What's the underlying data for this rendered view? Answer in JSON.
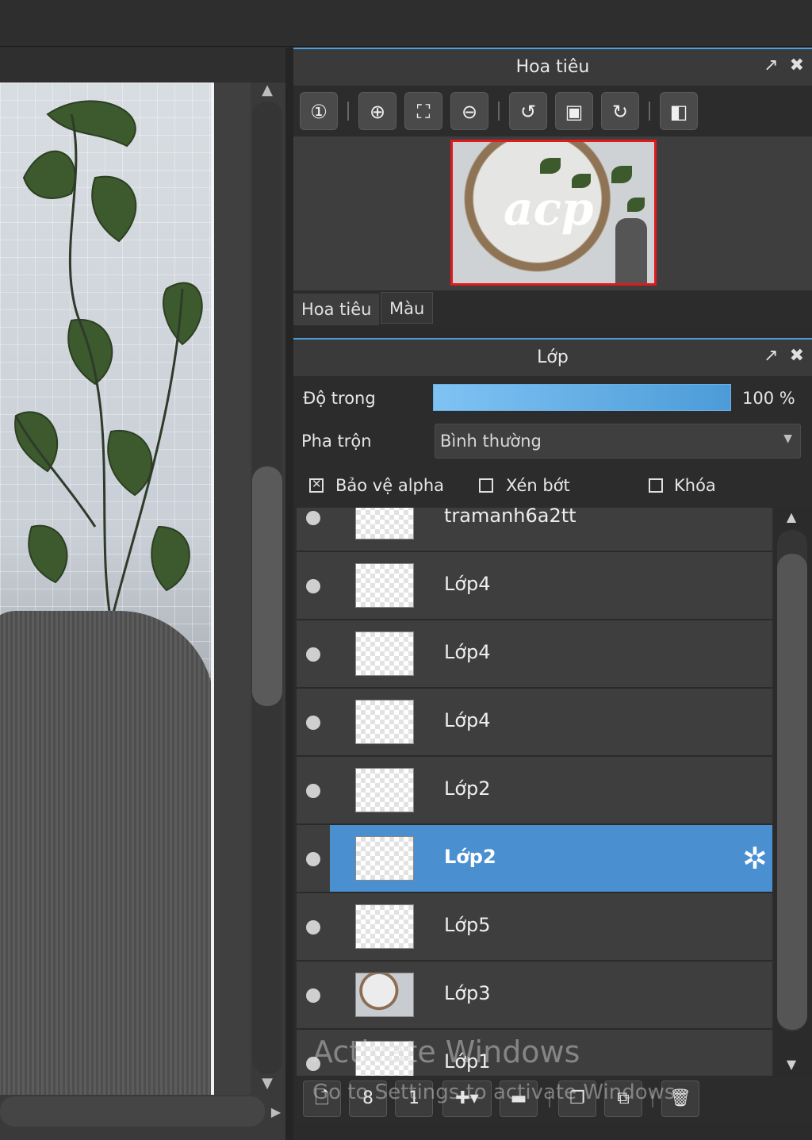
{
  "navigator": {
    "title": "Hoa tiêu",
    "popout_icon": "↗",
    "close_icon": "✖",
    "tools": [
      {
        "icon": "zoom-actual-icon",
        "glyph": "①"
      },
      {
        "icon": "zoom-in-icon",
        "glyph": "⊕"
      },
      {
        "icon": "fit-screen-icon",
        "glyph": "⛶"
      },
      {
        "icon": "zoom-out-icon",
        "glyph": "⊖"
      },
      {
        "icon": "rotate-left-icon",
        "glyph": "↺"
      },
      {
        "icon": "fit-window-icon",
        "glyph": "▣"
      },
      {
        "icon": "rotate-right-icon",
        "glyph": "↻"
      },
      {
        "icon": "flip-horizontal-icon",
        "glyph": "◧"
      }
    ],
    "preview_text": "acp",
    "tabs": [
      "Hoa tiêu",
      "Màu"
    ]
  },
  "layers_panel": {
    "title": "Lớp",
    "opacity_label": "Độ trong",
    "opacity_value": "100 %",
    "opacity_fraction": 1.0,
    "blend_label": "Pha trộn",
    "blend_value": "Bình thường",
    "checkboxes": [
      {
        "label": "Bảo vệ alpha",
        "checked": true
      },
      {
        "label": "Xén bớt",
        "checked": false
      },
      {
        "label": "Khóa",
        "checked": false
      }
    ],
    "layers": [
      {
        "name": "tramanh6a2tt",
        "selected": false,
        "thumb": "transparent"
      },
      {
        "name": "Lớp4",
        "selected": false,
        "thumb": "transparent"
      },
      {
        "name": "Lớp4",
        "selected": false,
        "thumb": "transparent"
      },
      {
        "name": "Lớp4",
        "selected": false,
        "thumb": "transparent"
      },
      {
        "name": "Lớp2",
        "selected": false,
        "thumb": "transparent"
      },
      {
        "name": "Lớp2",
        "selected": true,
        "thumb": "transparent"
      },
      {
        "name": "Lớp5",
        "selected": false,
        "thumb": "transparent"
      },
      {
        "name": "Lớp3",
        "selected": false,
        "thumb": "photo"
      },
      {
        "name": "Lớp1",
        "selected": false,
        "thumb": "transparent"
      }
    ],
    "gear_icon": "✲",
    "toolbar": [
      {
        "icon": "new-layer-icon",
        "glyph": "🗋"
      },
      {
        "icon": "new-8bit-layer-icon",
        "glyph": "8"
      },
      {
        "icon": "new-1bit-layer-icon",
        "glyph": "1"
      },
      {
        "icon": "add-layer-menu-icon",
        "glyph": "✚▾"
      },
      {
        "icon": "folder-icon",
        "glyph": "▬"
      },
      {
        "icon": "duplicate-layer-icon",
        "glyph": "❐"
      },
      {
        "icon": "merge-down-icon",
        "glyph": "⧉"
      },
      {
        "icon": "delete-layer-icon",
        "glyph": "🗑"
      }
    ]
  },
  "watermark": {
    "line1": "Activate Windows",
    "line2": "Go to Settings to activate Windows."
  }
}
